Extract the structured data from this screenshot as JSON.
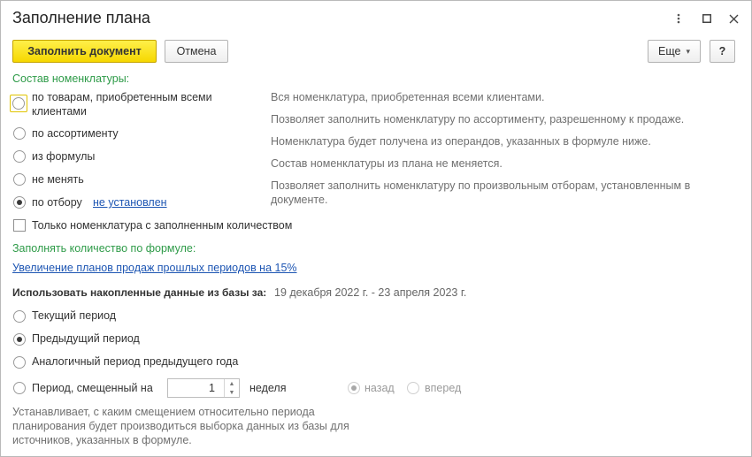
{
  "window": {
    "title": "Заполнение плана",
    "more_icon": "more-vert-icon",
    "maximize_icon": "maximize-icon",
    "close_icon": "close-icon"
  },
  "toolbar": {
    "fill_label": "Заполнить документ",
    "cancel_label": "Отмена",
    "more_label": "Еще",
    "more_arrow": "▾",
    "help_label": "?"
  },
  "composition": {
    "header": "Состав номенклатуры:",
    "options": [
      {
        "label_line1": "по товарам, приобретенным всеми",
        "label_line2": "клиентами",
        "desc": "Вся номенклатура, приобретенная всеми клиентами."
      },
      {
        "label": "по ассортименту",
        "desc": "Позволяет заполнить номенклатуру по ассортименту, разрешенному к продаже."
      },
      {
        "label": "из формулы",
        "desc": "Номенклатура будет получена из операндов, указанных в формуле ниже."
      },
      {
        "label": "не менять",
        "desc": "Состав номенклатуры из плана не меняется."
      },
      {
        "label": "по отбору",
        "link": "не установлен",
        "desc_line1": "Позволяет заполнить номенклатуру по произвольным отборам, установленным в",
        "desc_line2": "документе."
      }
    ],
    "only_with_qty_label": "Только номенклатура с заполненным количеством"
  },
  "formula": {
    "header": "Заполнять количество по формуле:",
    "link": "Увеличение планов продаж прошлых периодов на 15%"
  },
  "accumulated": {
    "label": "Использовать накопленные данные из базы за:",
    "period": "19 декабря 2022 г. - 23 апреля 2023 г.",
    "options": [
      {
        "label": "Текущий период"
      },
      {
        "label": "Предыдущий период"
      },
      {
        "label": "Аналогичный период предыдущего года"
      },
      {
        "label": "Период, смещенный на"
      }
    ],
    "offset_value": "1",
    "offset_unit": "неделя",
    "direction_back": "назад",
    "direction_forward": "вперед",
    "hint_line1": "Устанавливает, с каким смещением относительно периода",
    "hint_line2": "планирования будет производиться выборка данных из базы для",
    "hint_line3": "источников, указанных в формуле."
  },
  "colors": {
    "accent_green": "#2e9b48",
    "link_blue": "#1e56b3",
    "primary_yellow": "#f6d800"
  }
}
